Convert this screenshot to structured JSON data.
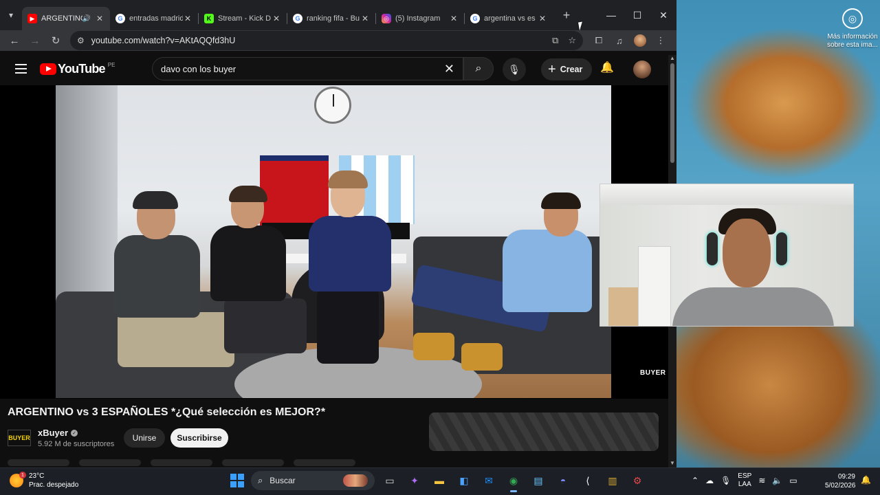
{
  "desktop": {
    "info_label": "Más información sobre esta ima..."
  },
  "browser": {
    "tabs": [
      {
        "title": "ARGENTINO vs 3 ESPAÑOLES",
        "favicon": "youtube-icon",
        "active": true,
        "audio": true
      },
      {
        "title": "entradas madrid",
        "favicon": "google-icon",
        "active": false
      },
      {
        "title": "Stream - Kick D",
        "favicon": "kick-icon",
        "active": false
      },
      {
        "title": "ranking fifa - Bu",
        "favicon": "google-icon",
        "active": false
      },
      {
        "title": "(5) Instagram",
        "favicon": "instagram-icon",
        "active": false
      },
      {
        "title": "argentina vs es",
        "favicon": "google-icon",
        "active": false
      }
    ],
    "url": "youtube.com/watch?v=AKtAQQfd3hU"
  },
  "youtube": {
    "logo_text": "YouTube",
    "country_code": "PE",
    "search_query": "davo con los buyer",
    "create_label": "Crear",
    "video": {
      "title": "ARGENTINO vs 3 ESPAÑOLES *¿Qué selección es MEJOR?*",
      "watermark": "BUYER"
    },
    "channel": {
      "avatar_text": "BUYER",
      "name": "xBuyer",
      "subscribers": "5.92 M de suscriptores",
      "join_label": "Unirse",
      "subscribe_label": "Suscribirse"
    }
  },
  "taskbar": {
    "weather": {
      "temp": "23°C",
      "condition": "Prac. despejado",
      "badge": "1"
    },
    "search_label": "Buscar",
    "language": {
      "line1": "ESP",
      "line2": "LAA"
    },
    "time": "09:29",
    "date": "5/02/2026"
  },
  "colors": {
    "youtube_red": "#ff0000",
    "windows_blue": "#3aa0ff",
    "chrome_dark": "#202124",
    "webcam_headset_glow": "#28e3d4"
  }
}
